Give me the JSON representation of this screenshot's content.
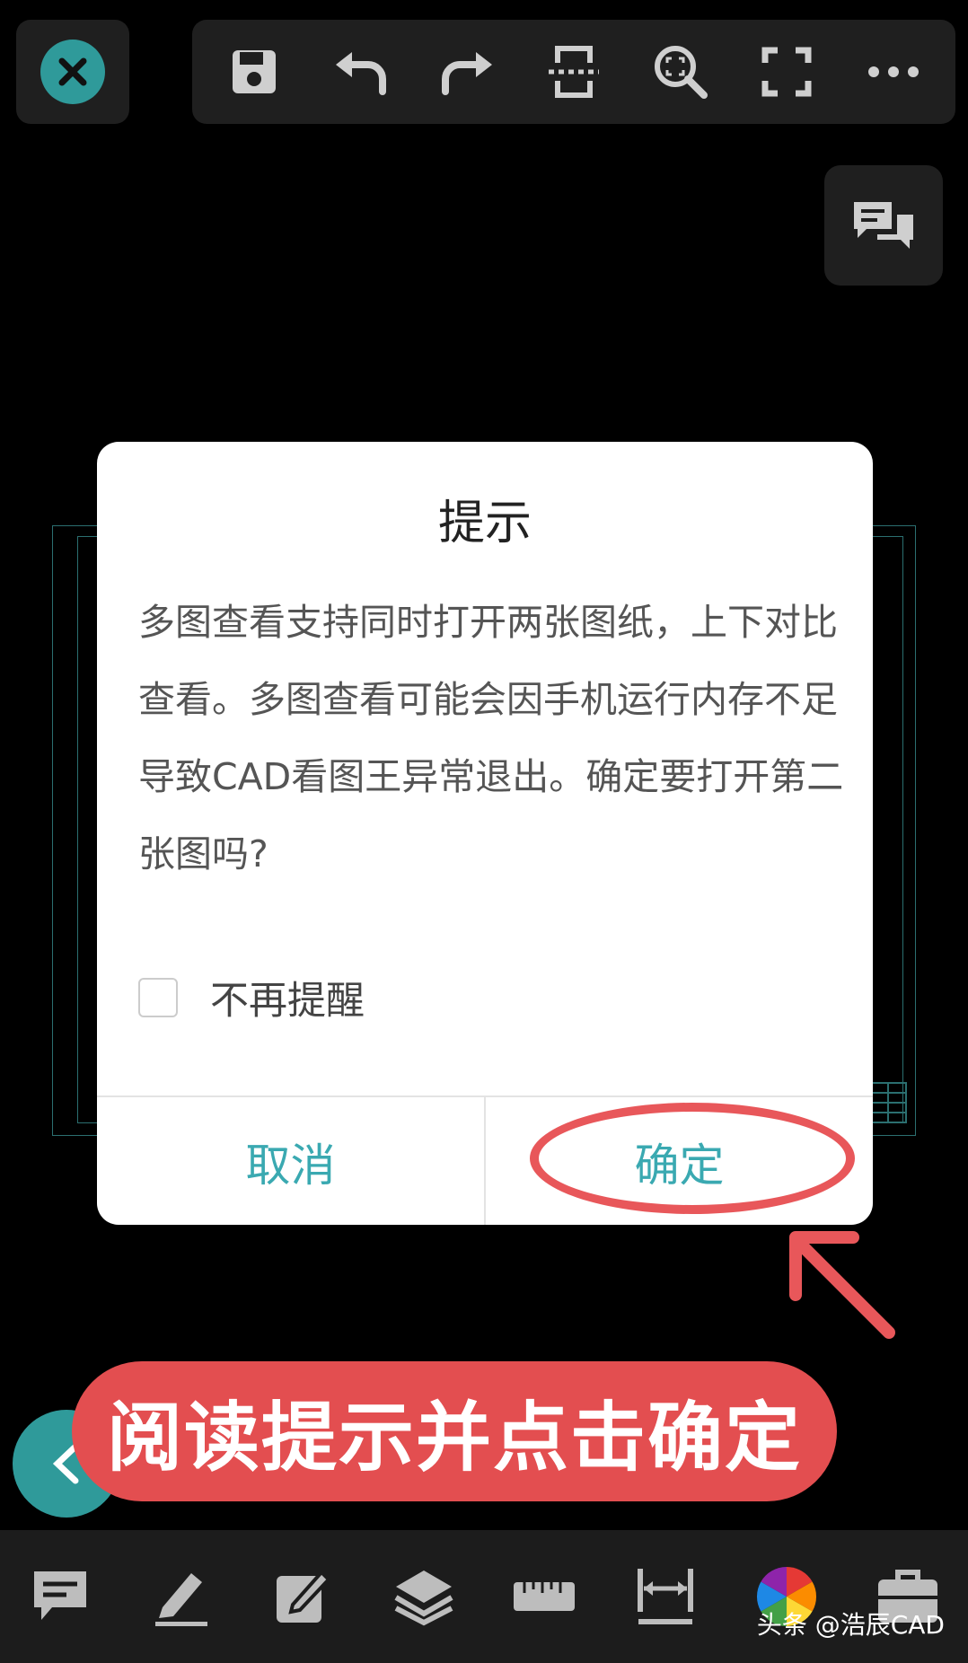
{
  "toolbar": {
    "icons": [
      "save-icon",
      "undo-icon",
      "redo-icon",
      "split-view-icon",
      "zoom-fit-icon",
      "fullscreen-icon",
      "more-icon"
    ]
  },
  "dialog": {
    "title": "提示",
    "message": "多图查看支持同时打开两张图纸，上下对比查看。多图查看可能会因手机运行内存不足导致CAD看图王异常退出。确定要打开第二张图吗?",
    "checkbox_label": "不再提醒",
    "checkbox_checked": false,
    "cancel_label": "取消",
    "confirm_label": "确定"
  },
  "annotation": {
    "banner_text": "阅读提示并点击确定"
  },
  "bottom_bar": {
    "icons": [
      "comment-icon",
      "pen-icon",
      "edit-icon",
      "layers-icon",
      "ruler-icon",
      "dimension-icon",
      "color-wheel-icon",
      "toolbox-icon"
    ]
  },
  "watermark": "头条 @浩辰CAD",
  "colors": {
    "accent": "#3aa9b1",
    "teal_button": "#2f9a9a",
    "annotation_red": "#e34e50"
  }
}
